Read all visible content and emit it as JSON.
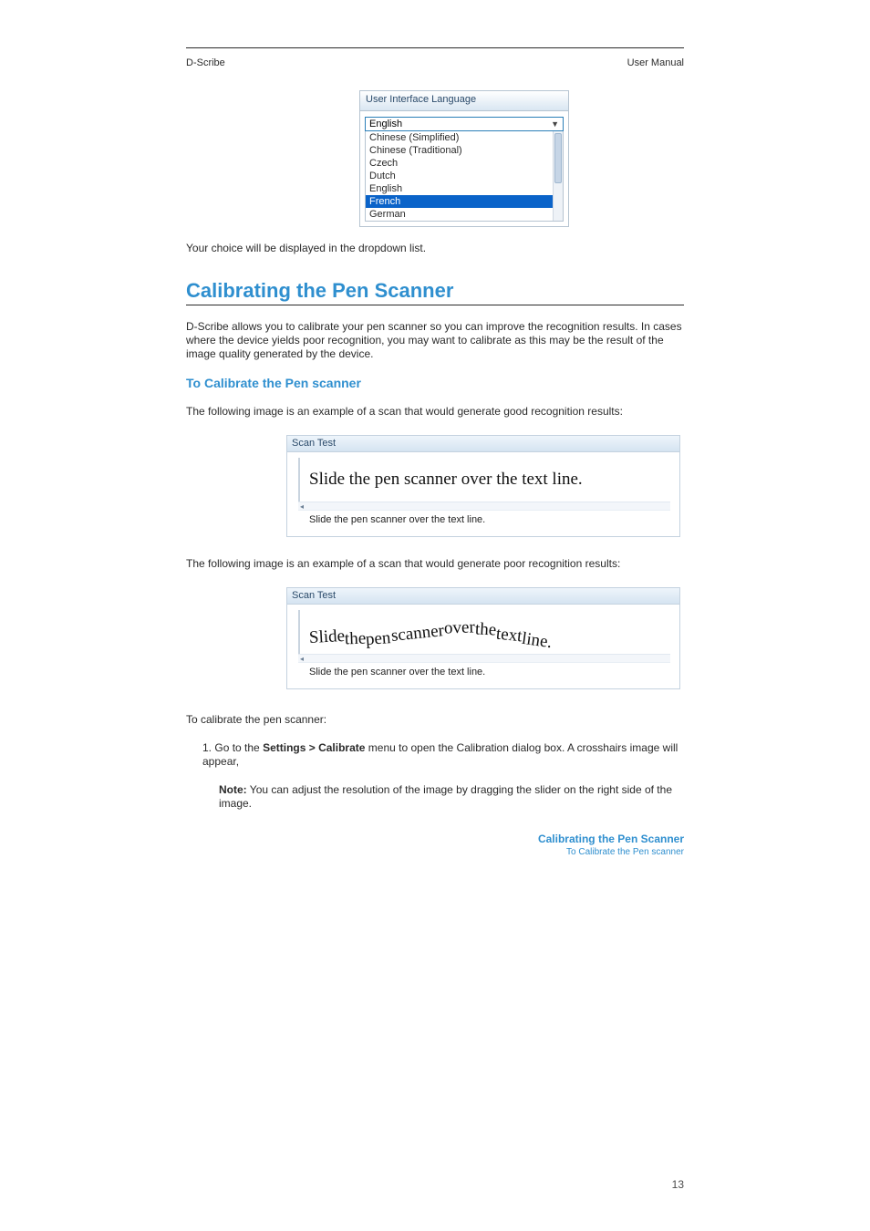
{
  "header": {
    "left": "D-Scribe",
    "right": "User Manual"
  },
  "uiLang": {
    "title": "User Interface Language",
    "selected": "English",
    "options": [
      "Chinese (Simplified)",
      "Chinese (Traditional)",
      "Czech",
      "Dutch",
      "English",
      "French",
      "German"
    ],
    "highlightedIndex": 5
  },
  "paragraphs": {
    "p1": "Your choice will be displayed in the dropdown list.",
    "p_after_title": "D-Scribe allows you to calibrate your pen scanner so you can improve the recognition results. In cases where the device yields poor recognition, you may want to calibrate as this may be the result of the image quality generated by the device.",
    "img1": "The following image is an example of a scan that would generate good recognition results:",
    "img2": "The following image is an example of a scan that would generate poor recognition results:",
    "cal_intro": "To calibrate the pen scanner:",
    "step1_num": "1.",
    "step1": "Go to the",
    "step1_b": "Settings > Calibrate",
    "step1_tail": " menu to open the Calibration dialog box. A crosshairs image will appear,",
    "noteLabel": "Note:",
    "noteBody": " You can adjust the resolution of the image by dragging the slider on the right side of the image."
  },
  "section": {
    "title": "Calibrating the Pen Scanner",
    "sub": "To Calibrate the Pen scanner"
  },
  "scan1": {
    "title": "Scan Test",
    "previewText": "Slide the pen scanner over the text line.",
    "resultText": "Slide the pen scanner over the text line."
  },
  "scan2": {
    "title": "Scan Test",
    "words": [
      "Slide ",
      "the ",
      "pen ",
      "scanner ",
      "over ",
      "the ",
      "text ",
      "line."
    ],
    "resultText": "Slide the pen scanner over the text line."
  },
  "closing": {
    "bold": "Calibrating the Pen Scanner",
    "small": "To Calibrate the Pen scanner"
  },
  "footer": {
    "page": "13"
  }
}
